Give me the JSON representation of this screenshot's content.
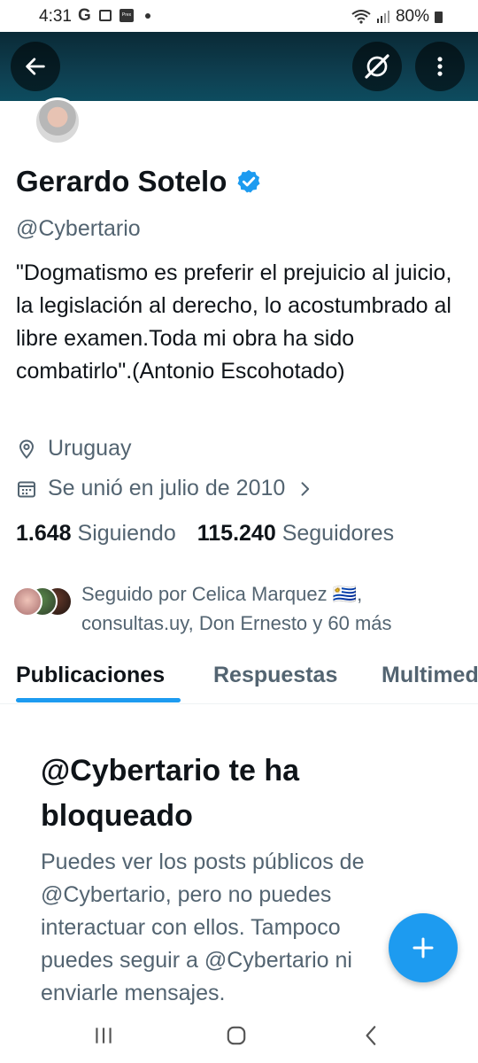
{
  "status_bar": {
    "time": "4:31",
    "g_label": "G",
    "prex_label": "Prex",
    "battery": "80%"
  },
  "header": {
    "back_icon": "arrow-left-icon",
    "grok_icon": "grok-icon",
    "more_icon": "more-vertical-icon",
    "banner_color": "#0e3d4e"
  },
  "profile": {
    "name": "Gerardo Sotelo",
    "handle": "@Cybertario",
    "bio": "\"Dogmatismo es preferir el prejuicio al juicio, la legislación al derecho, lo acostumbrado al libre examen.Toda mi obra ha sido combatirlo\".(Antonio Escohotado)",
    "location": "Uruguay",
    "joined": "Se unió en julio de 2010",
    "following_count": "1.648",
    "following_label": "Siguiendo",
    "followers_count": "115.240",
    "followers_label": "Seguidores",
    "followed_by": "Seguido por Celica Marquez 🇺🇾, consultas.uy, Don Ernesto y 60 más",
    "verified_color": "#1d9bf0"
  },
  "tabs": [
    {
      "label": "Publicaciones",
      "active": true
    },
    {
      "label": "Respuestas",
      "active": false
    },
    {
      "label": "Multimedia",
      "active": false
    }
  ],
  "blocked": {
    "title": "@Cybertario te ha bloqueado",
    "description": "Puedes ver los posts públicos de @Cybertario, pero no puedes interactuar con ellos. Tampoco puedes seguir a @Cybertario ni enviarle mensajes."
  },
  "fab_icon": "plus-icon",
  "colors": {
    "accent": "#1d9bf0",
    "secondary_text": "#536471",
    "primary_text": "#0f1419"
  },
  "navbar": {
    "recents_icon": "recents-icon",
    "home_icon": "home-icon",
    "back_icon": "back-chevron-icon"
  }
}
